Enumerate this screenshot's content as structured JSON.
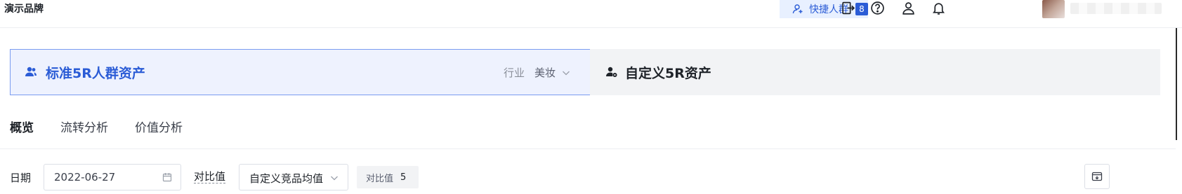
{
  "header": {
    "brand": "演示品牌",
    "quick_group_label": "快捷人群",
    "quick_group_count": "8",
    "icons": [
      "exit-icon",
      "help-icon",
      "user-icon",
      "bell-icon"
    ]
  },
  "cards": {
    "standard": {
      "title": "标准5R人群资产",
      "industry_label": "行业",
      "industry_value": "美妆"
    },
    "custom": {
      "title": "自定义5R资产"
    }
  },
  "tabs": [
    {
      "label": "概览",
      "active": true
    },
    {
      "label": "流转分析",
      "active": false
    },
    {
      "label": "价值分析",
      "active": false
    }
  ],
  "filters": {
    "date_label": "日期",
    "date_value": "2022-06-27",
    "compare_label": "对比值",
    "compare_select": "自定义竞品均值",
    "compare_chip_label": "对比值",
    "compare_chip_value": "5"
  },
  "colors": {
    "accent": "#2b5cd6",
    "accent_bg": "#eef2fe"
  }
}
